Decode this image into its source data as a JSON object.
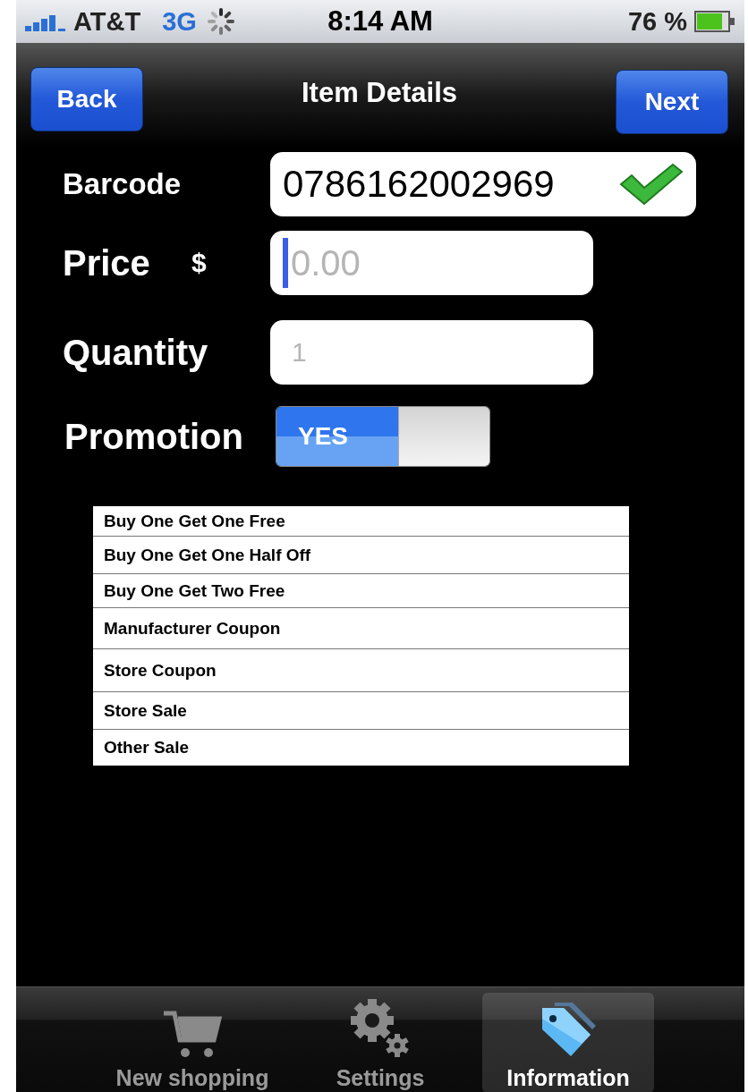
{
  "status_bar": {
    "carrier": "AT&T",
    "network": "3G",
    "time": "8:14 AM",
    "battery": "76 %"
  },
  "nav": {
    "back": "Back",
    "title": "Item Details",
    "next": "Next"
  },
  "fields": [
    {
      "kind": "barcode",
      "label": "Barcode",
      "value": "0786162002969",
      "valid": true
    },
    {
      "kind": "price",
      "label": "Price",
      "prefix": "$",
      "placeholder": "0.00",
      "focused": true
    },
    {
      "kind": "quantity",
      "label": "Quantity",
      "placeholder": "1",
      "focused": false
    },
    {
      "kind": "toggle",
      "label": "Promotion",
      "on": true,
      "on_label": "YES"
    }
  ],
  "promotions": [
    "Buy One Get One Free",
    "Buy One Get One Half Off",
    "Buy One Get Two Free",
    "Manufacturer Coupon",
    "Store Coupon",
    "Store Sale",
    "Other Sale"
  ],
  "tabs": [
    {
      "label": "New shopping",
      "selected": false
    },
    {
      "label": "Settings",
      "selected": false
    },
    {
      "label": "Information",
      "selected": true
    }
  ]
}
